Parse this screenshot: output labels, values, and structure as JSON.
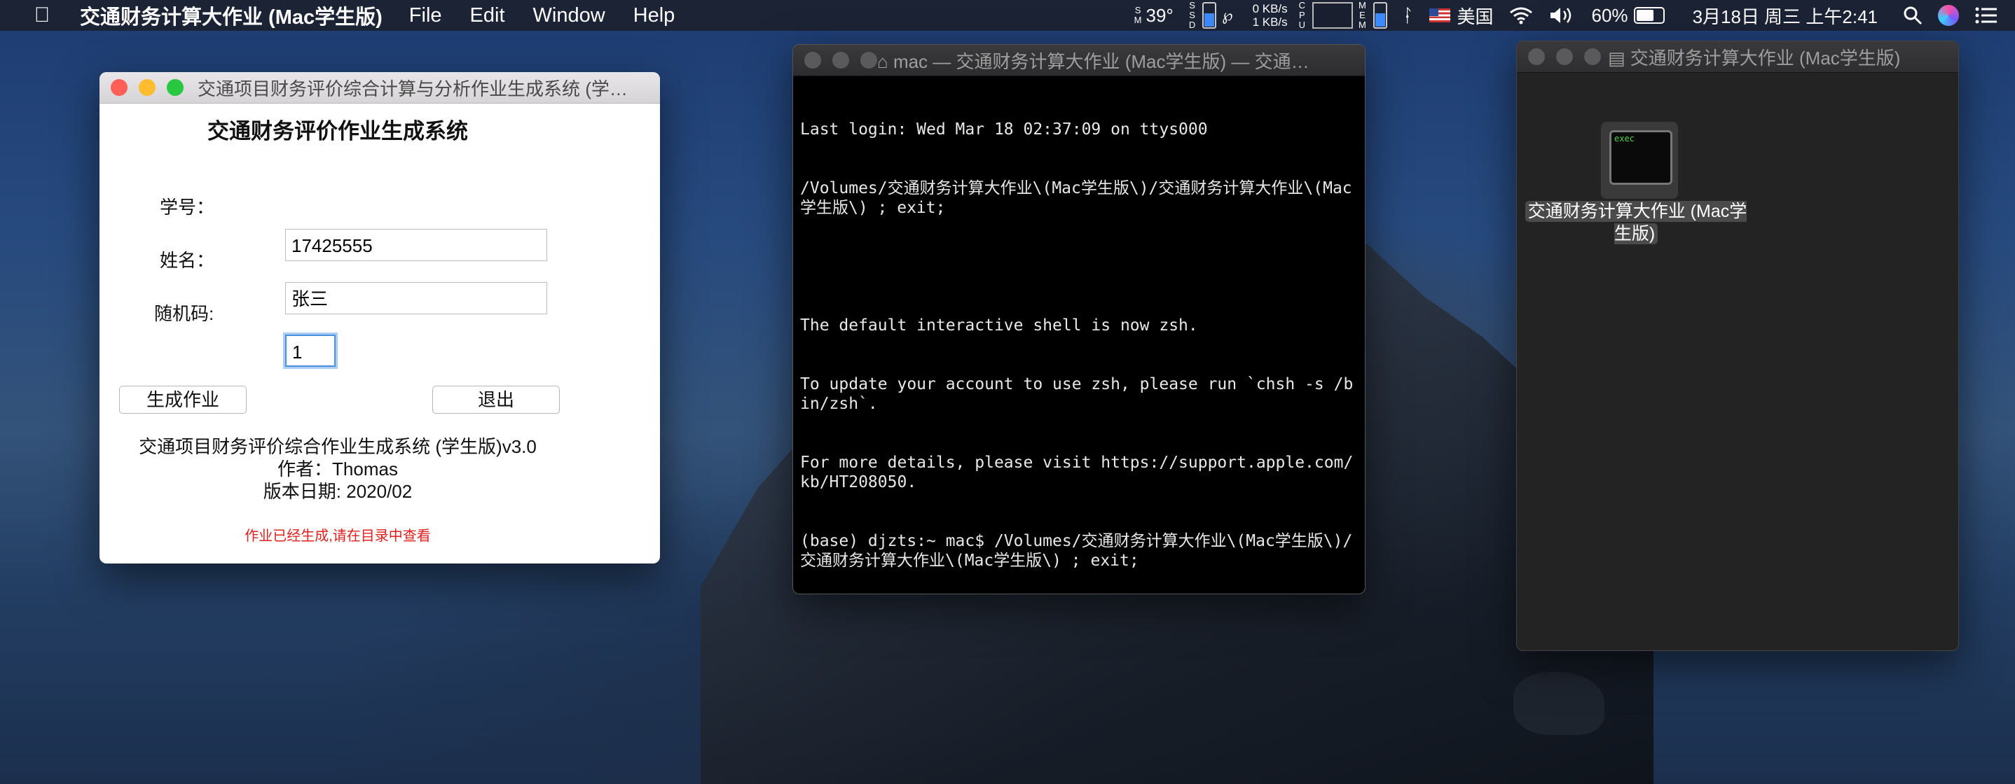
{
  "menubar": {
    "app_name": "交通财务计算大作业 (Mac学生版)",
    "menus": [
      "File",
      "Edit",
      "Window",
      "Help"
    ],
    "temperature": "39°",
    "net_up": "0 KB/s",
    "net_down": "1 KB/s",
    "input_source": "美国",
    "battery_percent": "60%",
    "battery_level": 0.6,
    "datetime": "3月18日 周三 上午2:41"
  },
  "app_window": {
    "title": "交通项目财务评价综合计算与分析作业生成系统 (学…",
    "heading": "交通财务评价作业生成系统",
    "student_id_label": "学号：",
    "student_id_value": "17425555",
    "name_label": "姓名：",
    "name_value": "张三",
    "random_label": "随机码:",
    "random_value": "1",
    "generate_button": "生成作业",
    "exit_button": "退出",
    "info_line1": "交通项目财务评价综合作业生成系统 (学生版)v3.0",
    "info_line2": "作者：Thomas",
    "info_line3": "版本日期: 2020/02",
    "status_message": "作业已经生成,请在目录中查看",
    "colors": {
      "status": "#e0201e",
      "close": "#fe5f57",
      "minimize": "#febc2e",
      "zoom": "#28c840"
    }
  },
  "terminal": {
    "title": "mac — 交通财务计算大作业 (Mac学生版) — 交通…",
    "lines": [
      "Last login: Wed Mar 18 02:37:09 on ttys000",
      "/Volumes/交通财务计算大作业\\(Mac学生版\\)/交通财务计算大作业\\(Mac学生版\\) ; exit;",
      "",
      "The default interactive shell is now zsh.",
      "To update your account to use zsh, please run `chsh -s /bin/zsh`.",
      "For more details, please visit https://support.apple.com/kb/HT208050.",
      "(base) djzts:~ mac$ /Volumes/交通财务计算大作业\\(Mac学生版\\)/交通财务计算大作业\\(Mac学生版\\) ; exit;"
    ]
  },
  "finder": {
    "title": "交通财务计算大作业 (Mac学生版)",
    "file_icon_text": "exec",
    "file_name": "交通财务计算大作业 (Mac学生版)"
  }
}
